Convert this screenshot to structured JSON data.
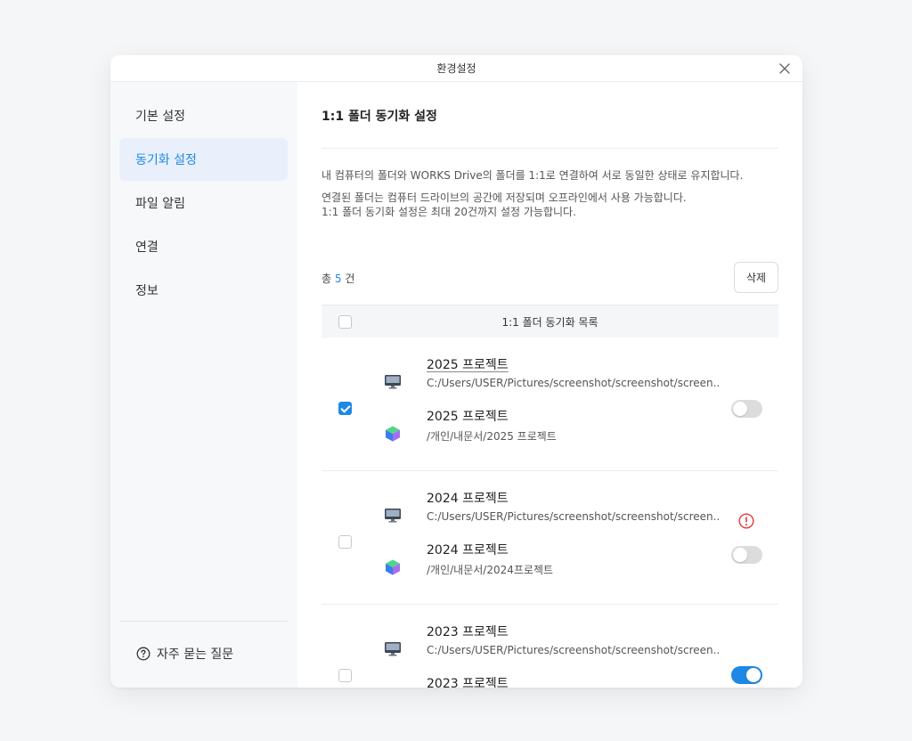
{
  "window": {
    "title": "환경설정"
  },
  "sidebar": {
    "items": [
      {
        "label": "기본 설정",
        "active": false
      },
      {
        "label": "동기화 설정",
        "active": true
      },
      {
        "label": "파일 알림",
        "active": false
      },
      {
        "label": "연결",
        "active": false
      },
      {
        "label": "정보",
        "active": false
      }
    ],
    "faq_label": "자주 묻는 질문"
  },
  "main": {
    "title": "1:1 폴더 동기화 설정",
    "descriptions": [
      "내 컴퓨터의 폴더와 WORKS Drive의 폴더를 1:1로 연결하여 서로 동일한 상태로 유지합니다.",
      "연결된 폴더는 컴퓨터 드라이브의 공간에 저장되며 오프라인에서 사용 가능합니다.",
      "1:1 폴더 동기화 설정은 최대 20건까지 설정 가능합니다."
    ],
    "count_prefix": "총",
    "count_value": "5",
    "count_suffix": "건",
    "delete_label": "삭제",
    "list_header": "1:1 폴더 동기화 목록",
    "rows": [
      {
        "checked": true,
        "local_name": "2025 프로젝트",
        "local_path": "C:/Users/USER/Pictures/screenshot/screenshot/screen..",
        "drive_name": "2025 프로젝트",
        "drive_path": "/개인/내문서/2025 프로젝트",
        "sync_on": false,
        "warning": false
      },
      {
        "checked": false,
        "local_name": "2024 프로젝트",
        "local_path": "C:/Users/USER/Pictures/screenshot/screenshot/screen..",
        "drive_name": "2024 프로젝트",
        "drive_path": "/개인/내문서/2024프로젝트",
        "sync_on": false,
        "warning": true
      },
      {
        "checked": false,
        "local_name": "2023 프로젝트",
        "local_path": "C:/Users/USER/Pictures/screenshot/screenshot/screen..",
        "drive_name": "2023 프로젝트",
        "drive_path": "",
        "sync_on": true,
        "warning": false
      }
    ]
  },
  "colors": {
    "accent": "#1e88e5",
    "warning": "#e53935",
    "toggle_off": "#dcdcdc"
  }
}
